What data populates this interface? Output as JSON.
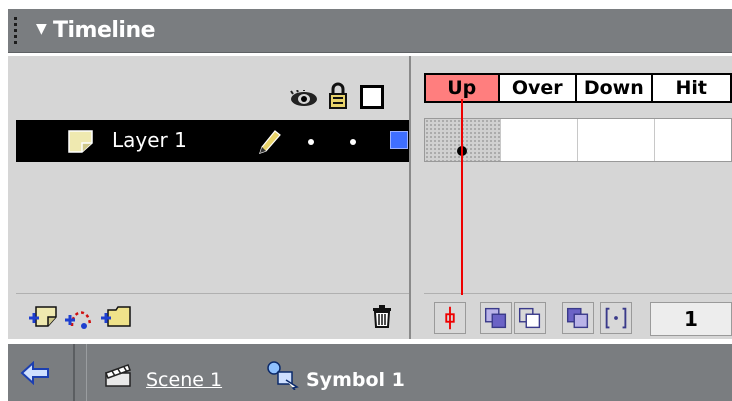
{
  "panel": {
    "title": "Timeline"
  },
  "layers": [
    {
      "name": "Layer 1"
    }
  ],
  "frame_labels": [
    "Up",
    "Over",
    "Down",
    "Hit"
  ],
  "current_frame": "1",
  "breadcrumb": {
    "scene": "Scene 1",
    "symbol": "Symbol 1"
  },
  "colors": {
    "up_frame": "#ff7e7e",
    "playhead": "#ee0000",
    "layer_outline": "#3f6fff",
    "panel_bar": "#7a7d80"
  },
  "icons": {
    "header": [
      "eye-icon",
      "lock-icon",
      "outline-icon"
    ],
    "layer": [
      "layer-icon",
      "pencil-icon"
    ],
    "footer": [
      "insert-layer-icon",
      "add-motion-guide-icon",
      "insert-layer-folder-icon",
      "trash-icon"
    ],
    "onion": [
      "center-frame-icon",
      "onion-skin-icon",
      "onion-skin-outlines-icon",
      "edit-multiple-frames-icon",
      "modify-onion-markers-icon"
    ],
    "nav": [
      "back-arrow-icon",
      "scene-icon",
      "symbol-icon"
    ]
  }
}
